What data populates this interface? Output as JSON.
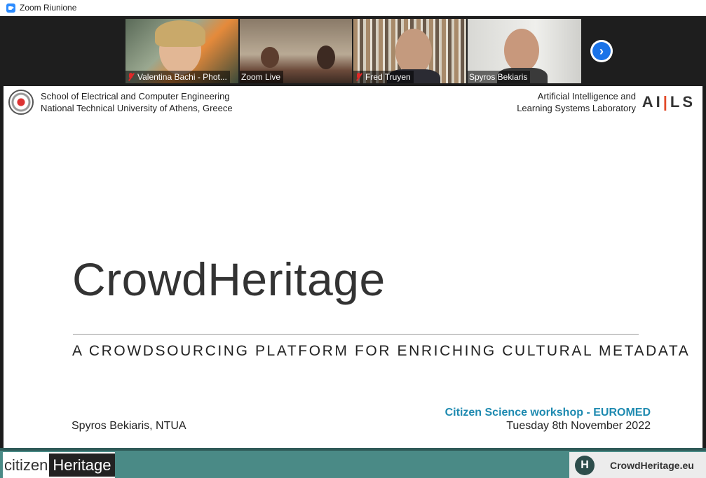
{
  "window": {
    "title": "Zoom Riunione"
  },
  "participants": [
    {
      "name": "Valentina Bachi - Phot...",
      "muted": true
    },
    {
      "name": "Zoom Live",
      "muted": false
    },
    {
      "name": "Fred Truyen",
      "muted": true
    },
    {
      "name": "Spyros Bekiaris",
      "muted": false
    }
  ],
  "next_page_icon": "chevron-right-icon",
  "slide": {
    "header_left_line1": "School of Electrical and Computer Engineering",
    "header_left_line2": "National Technical University of Athens, Greece",
    "header_right_line1": "Artificial Intelligence and",
    "header_right_line2": "Learning Systems Laboratory",
    "ails_logo": {
      "a": "A",
      "i": "I",
      "bar": "|",
      "ls": "LS"
    },
    "title": "CrowdHeritage",
    "subtitle": "A CROWDSOURCING PLATFORM FOR ENRICHING CULTURAL METADATA",
    "presenter": "Spyros Bekiaris, NTUA",
    "event": "Citizen Science workshop - EUROMED",
    "date": "Tuesday 8th November 2022",
    "footer_left_citizen": "citizen",
    "footer_left_heritage": "Heritage",
    "footer_right_mark": "H",
    "footer_right_site": "CrowdHeritage.eu"
  },
  "colors": {
    "accent": "#1e8ab0",
    "footer": "#4a8a86",
    "active_speaker": "#b4c94a",
    "mute": "#e02828"
  }
}
